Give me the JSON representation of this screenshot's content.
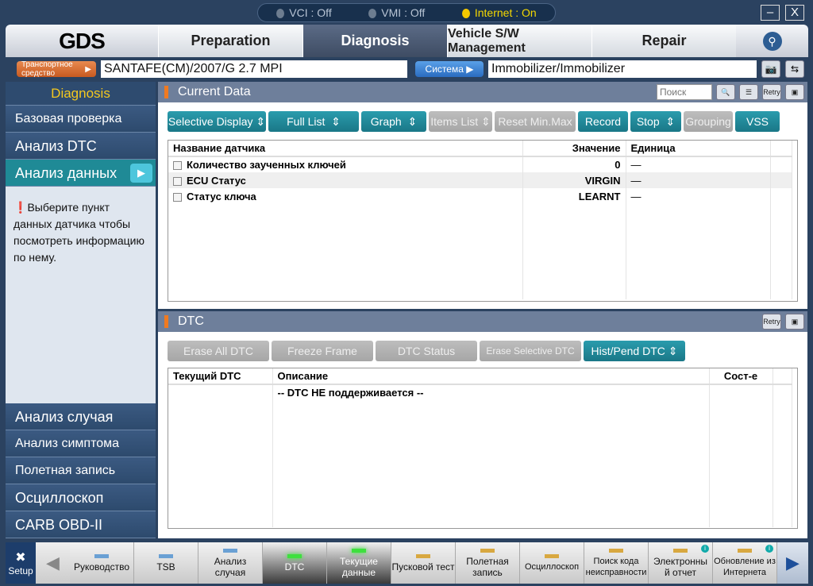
{
  "status": {
    "vci": "VCI : Off",
    "vmi": "VMI : Off",
    "internet": "Internet : On"
  },
  "window": {
    "minimize": "–",
    "close": "X"
  },
  "nav": {
    "logo": "GDS",
    "tabs": [
      "Preparation",
      "Diagnosis",
      "Vehicle S/W Management",
      "Repair"
    ],
    "active": "Diagnosis"
  },
  "vehicle": {
    "label": "Транспортное средство",
    "value": "SANTAFE(CM)/2007/G 2.7 MPI",
    "system_label": "Система",
    "system_value": "Immobilizer/Immobilizer"
  },
  "sidebar": {
    "header": "Diagnosis",
    "items": [
      "Базовая проверка",
      "Анализ DTC",
      "Анализ данных"
    ],
    "hint": "Выберите пункт данных датчика чтобы посмотреть информацию по нему.",
    "bottom": [
      "Анализ случая",
      "Анализ симптома",
      "Полетная запись",
      "Осциллоскоп",
      "CARB OBD-II"
    ]
  },
  "current": {
    "title": "Current Data",
    "search_placeholder": "Поиск",
    "retry": "Retry",
    "buttons": [
      "Selective Display",
      "Full List",
      "Graph",
      "Items List",
      "Reset Min.Max",
      "Record",
      "Stop",
      "Grouping",
      "VSS"
    ],
    "columns": [
      "Название датчика",
      "Значение",
      "Единица"
    ],
    "rows": [
      [
        "Количество заученных ключей",
        "0",
        "—"
      ],
      [
        "ECU Статус",
        "VIRGIN",
        "—"
      ],
      [
        "Статус ключа",
        "LEARNT",
        "—"
      ]
    ]
  },
  "dtc": {
    "title": "DTC",
    "retry": "Retry",
    "buttons": [
      "Erase All DTC",
      "Freeze Frame",
      "DTC Status",
      "Erase Selective DTC",
      "Hist/Pend DTC"
    ],
    "columns": [
      "Текущий DTC",
      "Описание",
      "Сост-е"
    ],
    "message": "-- DTC НЕ поддерживается --"
  },
  "bottombar": {
    "setup": "Setup",
    "items": [
      "Руководство",
      "TSB",
      "Анализ случая",
      "DTC",
      "Текущие данные",
      "Пусковой тест",
      "Полетная запись",
      "Осциллоскоп",
      "Поиск кода неисправности",
      "Электронный отчет",
      "Обновление из Интернета"
    ]
  }
}
